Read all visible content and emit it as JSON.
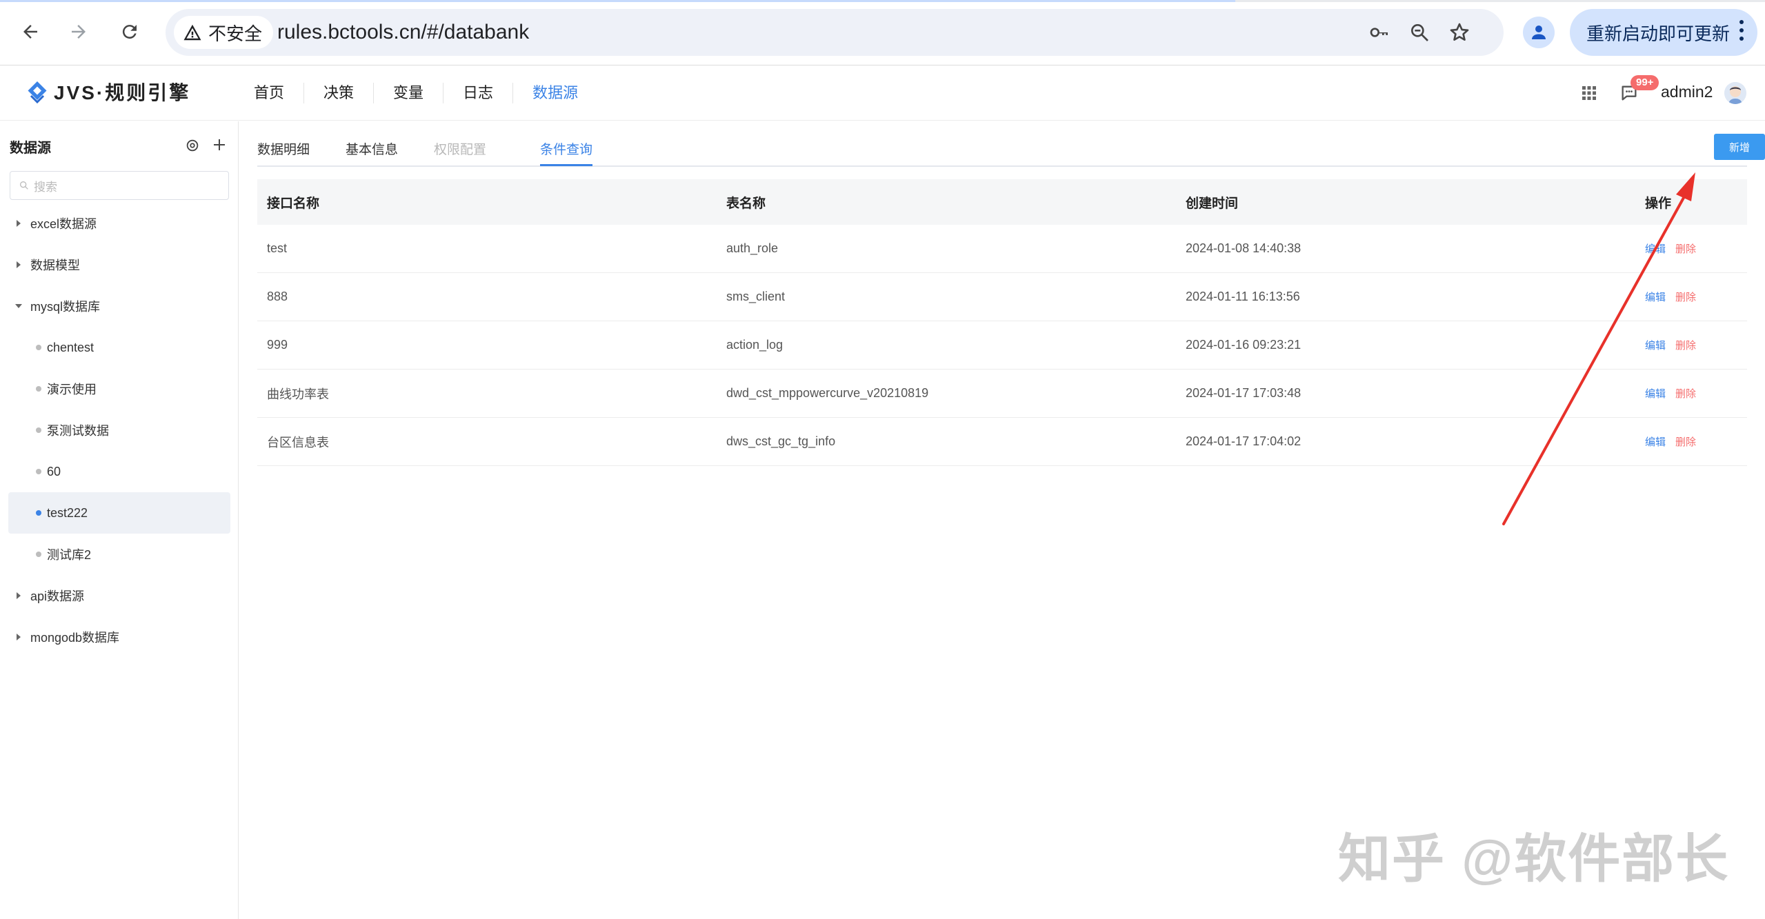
{
  "browser": {
    "security_label": "不安全",
    "url": "rules.bctools.cn/#/databank",
    "update_label": "重新启动即可更新"
  },
  "app": {
    "logo_text": "JVS·规则引擎",
    "nav": [
      {
        "label": "首页"
      },
      {
        "label": "决策"
      },
      {
        "label": "变量"
      },
      {
        "label": "日志"
      },
      {
        "label": "数据源",
        "active": true
      }
    ],
    "badge": "99+",
    "username": "admin2"
  },
  "sidebar": {
    "title": "数据源",
    "search_placeholder": "搜索",
    "tree": [
      {
        "label": "excel数据源"
      },
      {
        "label": "数据模型"
      },
      {
        "label": "mysql数据库"
      },
      {
        "label": "chentest"
      },
      {
        "label": "演示使用"
      },
      {
        "label": "泵测试数据"
      },
      {
        "label": "60"
      },
      {
        "label": "test222"
      },
      {
        "label": "测试库2"
      },
      {
        "label": "api数据源"
      },
      {
        "label": "mongodb数据库"
      }
    ]
  },
  "main": {
    "tabs": [
      {
        "label": "数据明细"
      },
      {
        "label": "基本信息"
      },
      {
        "label": "权限配置"
      },
      {
        "label": "条件查询"
      }
    ],
    "add_button": "新增",
    "table": {
      "headers": [
        "接口名称",
        "表名称",
        "创建时间",
        "操作"
      ],
      "rows": [
        {
          "name": "test",
          "table": "auth_role",
          "created": "2024-01-08 14:40:38"
        },
        {
          "name": "888",
          "table": "sms_client",
          "created": "2024-01-11 16:13:56"
        },
        {
          "name": "999",
          "table": "action_log",
          "created": "2024-01-16 09:23:21"
        },
        {
          "name": "曲线功率表",
          "table": "dwd_cst_mppowercurve_v20210819",
          "created": "2024-01-17 17:03:48"
        },
        {
          "name": "台区信息表",
          "table": "dws_cst_gc_tg_info",
          "created": "2024-01-17 17:04:02"
        }
      ],
      "edit_label": "编辑",
      "delete_label": "删除"
    }
  },
  "watermark": "知乎 @软件部长",
  "colors": {
    "accent": "#3b83e6",
    "button": "#3b9af0",
    "danger": "#f56c6c",
    "arrow": "#e8312a"
  }
}
